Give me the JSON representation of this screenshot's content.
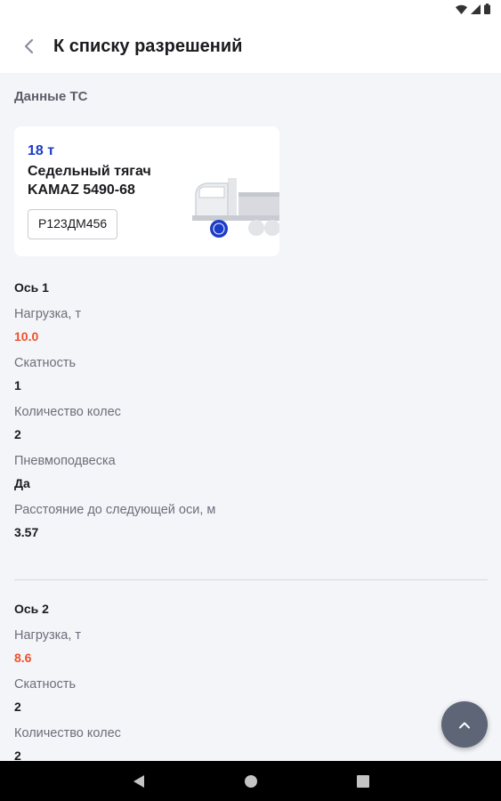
{
  "header": {
    "title": "К списку разрешений",
    "back_icon": "chevron-left-icon"
  },
  "section_title": "Данные ТС",
  "vehicle": {
    "weight": "18 т",
    "name_line1": "Седельный тягач",
    "name_line2": "KAMAZ 5490-68",
    "plate": "Р123ДМ456"
  },
  "axles": [
    {
      "title": "Ось 1",
      "load_label": "Нагрузка, т",
      "load_value": "10.0",
      "tires_label": "Скатность",
      "tires_value": "1",
      "wheels_label": "Количество колес",
      "wheels_value": "2",
      "suspension_label": "Пневмоподвеска",
      "suspension_value": "Да",
      "distance_label": "Расстояние до следующей оси, м",
      "distance_value": "3.57"
    },
    {
      "title": "Ось 2",
      "load_label": "Нагрузка, т",
      "load_value": "8.6",
      "tires_label": "Скатность",
      "tires_value": "2",
      "wheels_label": "Количество колес",
      "wheels_value": "2"
    }
  ],
  "colors": {
    "accent_blue": "#1a3cc8",
    "load_orange": "#f0502a",
    "fab": "#5d6576"
  }
}
